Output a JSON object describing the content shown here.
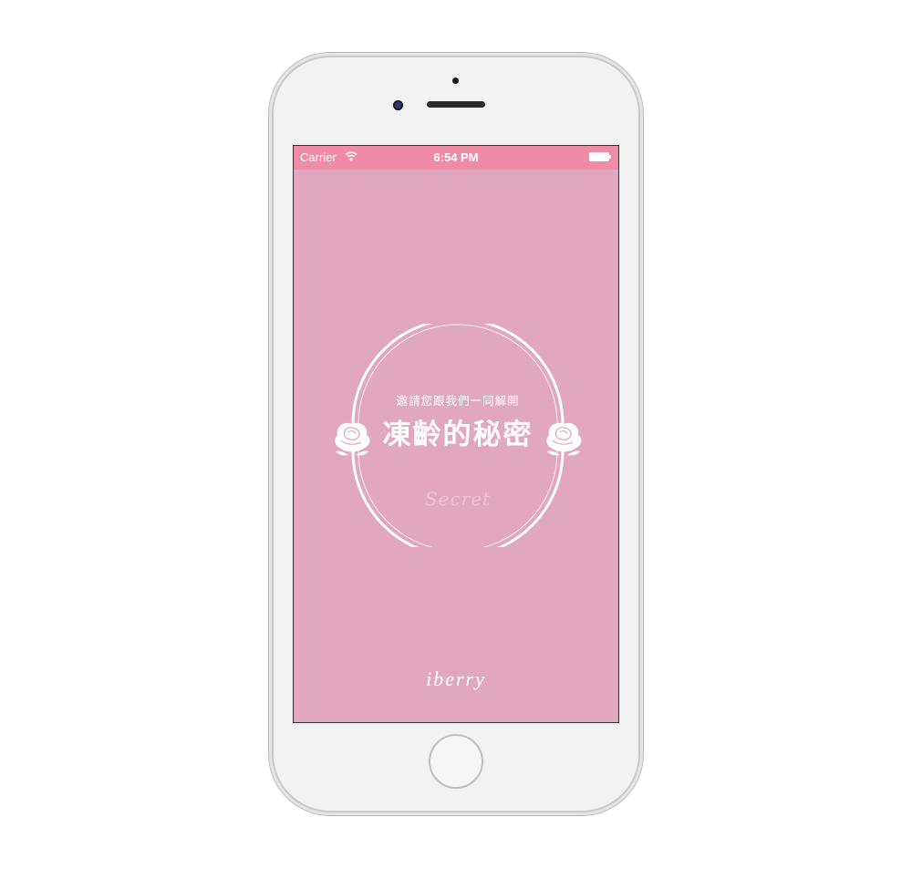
{
  "status_bar": {
    "carrier": "Carrier",
    "time": "6:54 PM",
    "wifi_icon": "wifi-icon",
    "battery_icon": "battery-icon"
  },
  "splash": {
    "invite_text": "邀請您跟我們一同解開",
    "title": "凍齡的秘密",
    "secret_script": "Secret",
    "brand": "iberry",
    "decor_icon": "rose-icon"
  },
  "colors": {
    "screen_bg": "#e0a7bf",
    "status_bar_bg": "#ef8ba6",
    "foreground": "#ffffff"
  }
}
